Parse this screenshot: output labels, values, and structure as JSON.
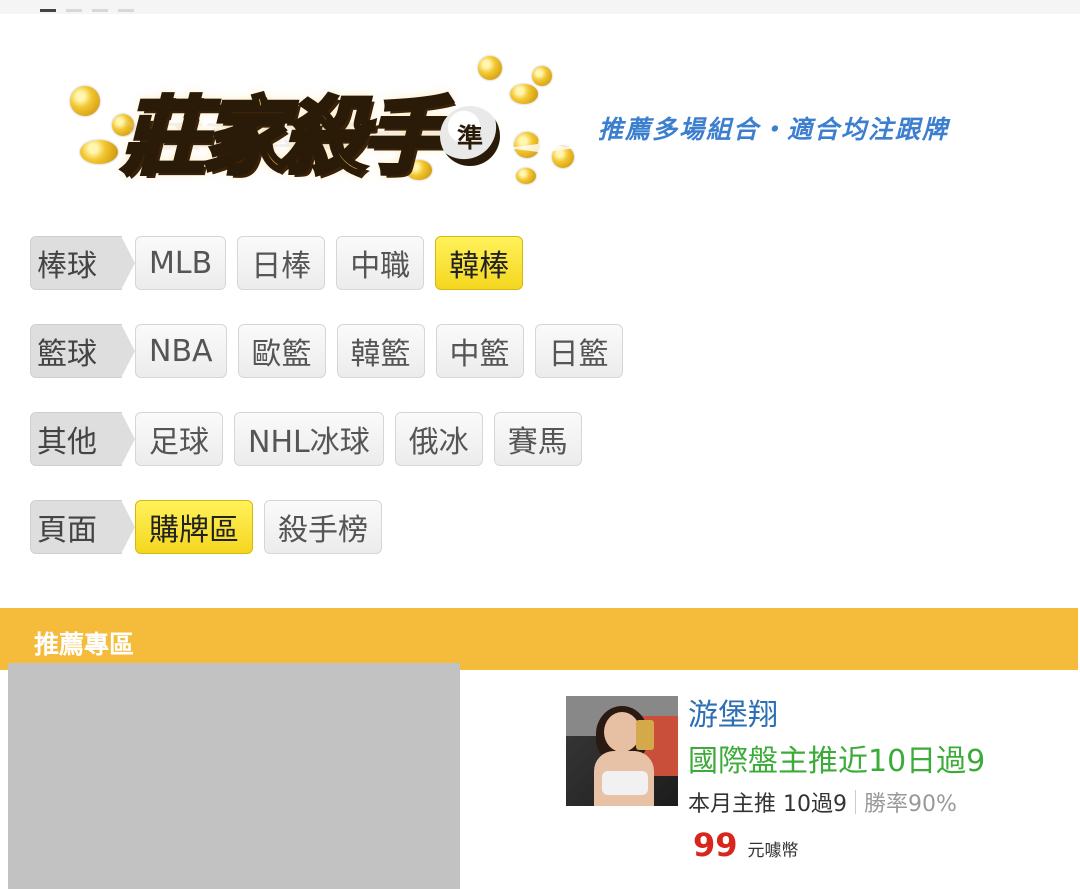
{
  "carousel": {
    "count": 4,
    "active_index": 0
  },
  "logo": {
    "title": "莊家殺手",
    "badge": "準"
  },
  "slogan": "推薦多場組合・適合均注跟牌",
  "categories": [
    {
      "label": "棒球",
      "items": [
        {
          "label": "MLB",
          "active": false
        },
        {
          "label": "日棒",
          "active": false
        },
        {
          "label": "中職",
          "active": false
        },
        {
          "label": "韓棒",
          "active": true
        }
      ]
    },
    {
      "label": "籃球",
      "items": [
        {
          "label": "NBA",
          "active": false
        },
        {
          "label": "歐籃",
          "active": false
        },
        {
          "label": "韓籃",
          "active": false
        },
        {
          "label": "中籃",
          "active": false
        },
        {
          "label": "日籃",
          "active": false
        }
      ]
    },
    {
      "label": "其他",
      "items": [
        {
          "label": "足球",
          "active": false
        },
        {
          "label": "NHL冰球",
          "active": false
        },
        {
          "label": "俄冰",
          "active": false
        },
        {
          "label": "賽馬",
          "active": false
        }
      ]
    },
    {
      "label": "頁面",
      "items": [
        {
          "label": "購牌區",
          "active": true
        },
        {
          "label": "殺手榜",
          "active": false
        }
      ]
    }
  ],
  "recommend": {
    "section_title": "推薦專區",
    "name": "游堡翔",
    "description": "國際盤主推近10日過9",
    "stats_main": "本月主推 10過9",
    "stats_rate": "勝率90%",
    "price": "99",
    "price_unit": "元噱幣"
  },
  "colors": {
    "accent_yellow": "#f5bc3c",
    "active_button": "#f4d61f",
    "link_blue": "#2d6fb5",
    "green": "#3cab3a",
    "price_red": "#d9261c"
  }
}
